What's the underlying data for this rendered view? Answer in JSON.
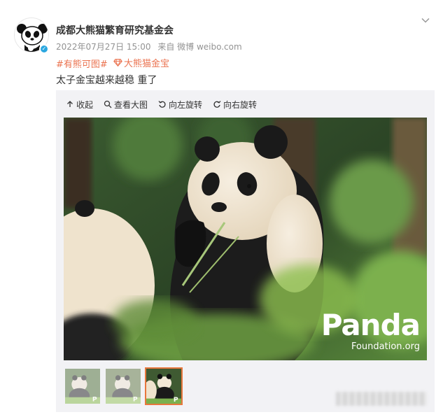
{
  "user": {
    "name": "成都大熊猫繁育研究基金会",
    "verified_mark": "✓"
  },
  "meta": {
    "timestamp": "2022年07月27日 15:00",
    "source": "来自 微博 weibo.com"
  },
  "tags": {
    "topic": "#有熊可图#",
    "super_topic": "大熊猫金宝"
  },
  "post": {
    "text": "太子金宝越来越稳 重了"
  },
  "toolbar": {
    "collapse": "收起",
    "view_large": "查看大图",
    "rotate_left": "向左旋转",
    "rotate_right": "向右旋转"
  },
  "watermark": {
    "big": "Panda",
    "small": "Foundation.org"
  },
  "thumbnails": {
    "count": 3,
    "active_index": 2
  },
  "colors": {
    "tag": "#eb7350",
    "panel_bg": "#f2f2f5",
    "active_border": "#e8773d"
  }
}
